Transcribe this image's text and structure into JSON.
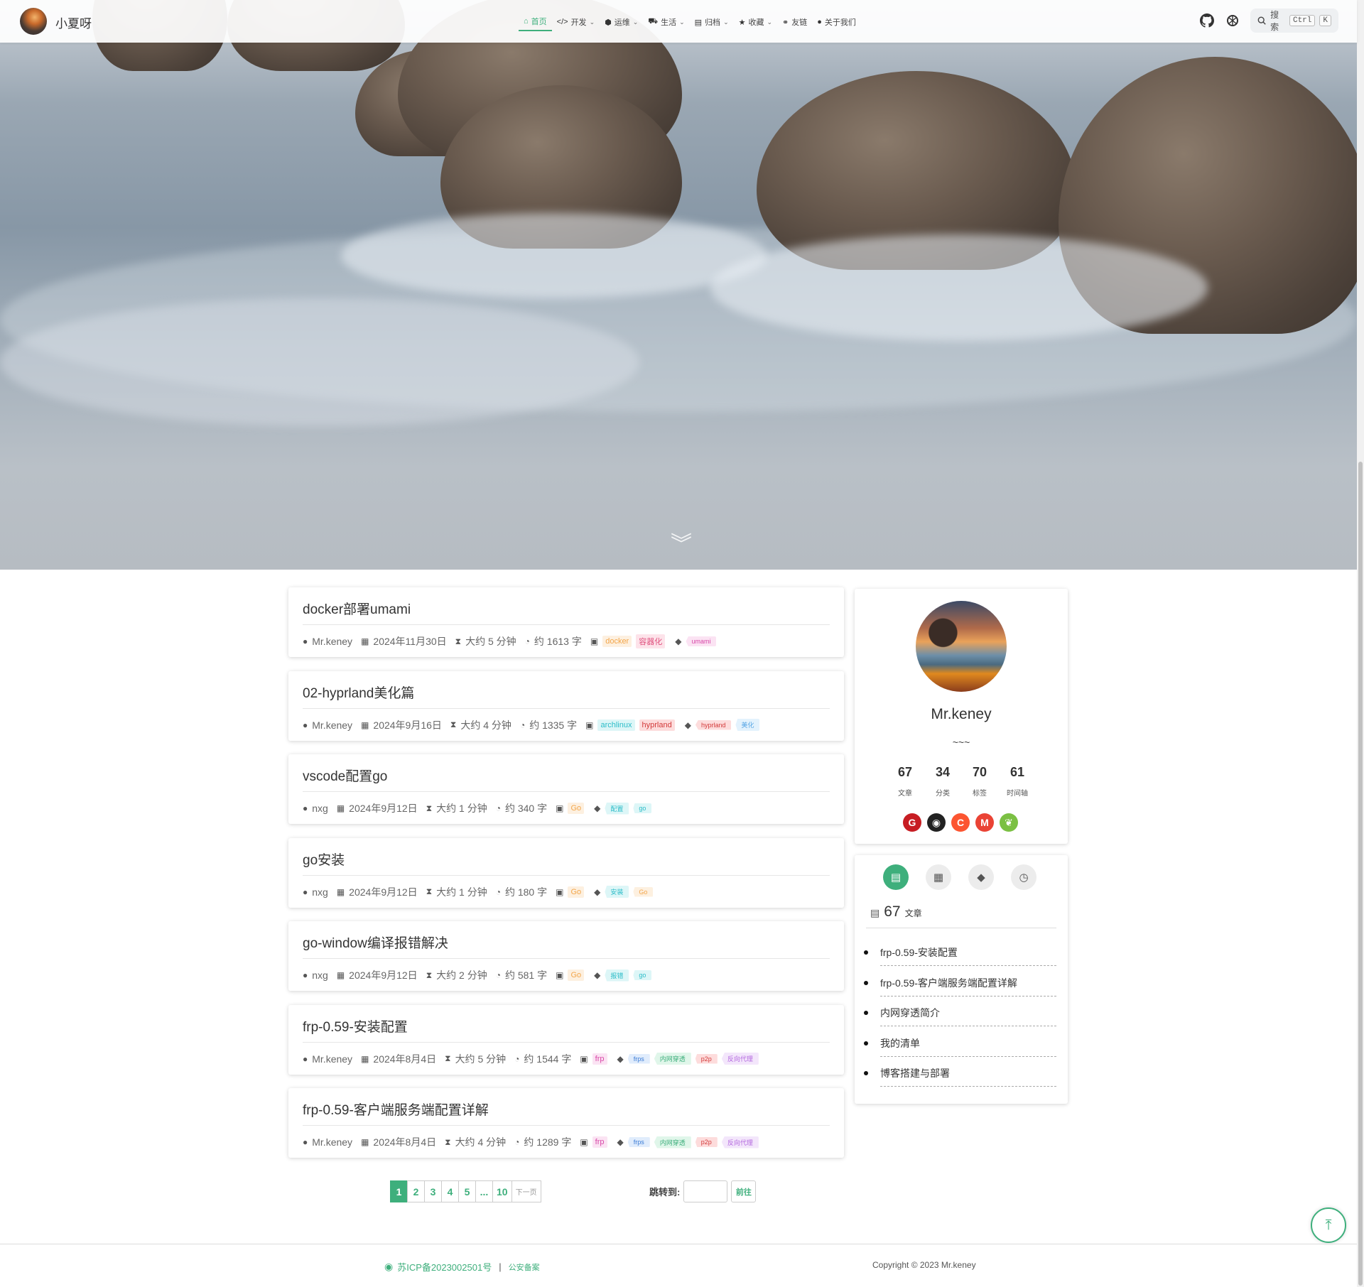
{
  "header": {
    "site_title": "小夏呀",
    "nav": [
      {
        "icon": "home-icon",
        "label": "首页",
        "dropdown": false,
        "active": true
      },
      {
        "icon": "code-icon",
        "label": "开发",
        "dropdown": true
      },
      {
        "icon": "box-icon",
        "label": "运维",
        "dropdown": true
      },
      {
        "icon": "car-icon",
        "label": "生活",
        "dropdown": true
      },
      {
        "icon": "calendar-icon",
        "label": "归档",
        "dropdown": true
      },
      {
        "icon": "star-icon",
        "label": "收藏",
        "dropdown": true
      },
      {
        "icon": "link-icon",
        "label": "友链",
        "dropdown": false
      },
      {
        "icon": "user-icon",
        "label": "关于我们",
        "dropdown": false
      }
    ],
    "search": {
      "label": "搜索",
      "key1": "Ctrl",
      "key2": "K"
    },
    "github_icon": "github-icon",
    "theme_icon": "theme-icon"
  },
  "posts": [
    {
      "title": "docker部署umami",
      "author": "Mr.keney",
      "date": "2024年11月30日",
      "read": "大约 5 分钟",
      "words": "约 1613 字",
      "categories": [
        {
          "text": "docker",
          "color": "orange"
        },
        {
          "text": "容器化",
          "color": "pink"
        }
      ],
      "tags": [
        {
          "text": "umami",
          "color": "magenta"
        }
      ]
    },
    {
      "title": "02-hyprland美化篇",
      "author": "Mr.keney",
      "date": "2024年9月16日",
      "read": "大约 4 分钟",
      "words": "约 1335 字",
      "categories": [
        {
          "text": "archlinux",
          "color": "cyan"
        },
        {
          "text": "hyprland",
          "color": "red"
        }
      ],
      "tags": [
        {
          "text": "hyprland",
          "color": "red"
        },
        {
          "text": "美化",
          "color": "lblue"
        }
      ]
    },
    {
      "title": "vscode配置go",
      "author": "nxg",
      "date": "2024年9月12日",
      "read": "大约 1 分钟",
      "words": "约 340 字",
      "categories": [
        {
          "text": "Go",
          "color": "orange"
        }
      ],
      "tags": [
        {
          "text": "配置",
          "color": "cyan"
        },
        {
          "text": "go",
          "color": "cyan"
        }
      ]
    },
    {
      "title": "go安装",
      "author": "nxg",
      "date": "2024年9月12日",
      "read": "大约 1 分钟",
      "words": "约 180 字",
      "categories": [
        {
          "text": "Go",
          "color": "orange"
        }
      ],
      "tags": [
        {
          "text": "安装",
          "color": "cyan"
        },
        {
          "text": "Go",
          "color": "orange"
        }
      ]
    },
    {
      "title": "go-window编译报错解决",
      "author": "nxg",
      "date": "2024年9月12日",
      "read": "大约 2 分钟",
      "words": "约 581 字",
      "categories": [
        {
          "text": "Go",
          "color": "orange"
        }
      ],
      "tags": [
        {
          "text": "报错",
          "color": "cyan"
        },
        {
          "text": "go",
          "color": "cyan"
        }
      ]
    },
    {
      "title": "frp-0.59-安装配置",
      "author": "Mr.keney",
      "date": "2024年8月4日",
      "read": "大约 5 分钟",
      "words": "约 1544 字",
      "categories": [
        {
          "text": "frp",
          "color": "magenta"
        }
      ],
      "tags": [
        {
          "text": "frps",
          "color": "blue"
        },
        {
          "text": "内网穿透",
          "color": "green"
        },
        {
          "text": "p2p",
          "color": "red"
        },
        {
          "text": "反向代理",
          "color": "purple"
        }
      ]
    },
    {
      "title": "frp-0.59-客户端服务端配置详解",
      "author": "Mr.keney",
      "date": "2024年8月4日",
      "read": "大约 4 分钟",
      "words": "约 1289 字",
      "categories": [
        {
          "text": "frp",
          "color": "magenta"
        }
      ],
      "tags": [
        {
          "text": "frps",
          "color": "blue"
        },
        {
          "text": "内网穿透",
          "color": "green"
        },
        {
          "text": "p2p",
          "color": "red"
        },
        {
          "text": "反向代理",
          "color": "purple"
        }
      ]
    }
  ],
  "profile": {
    "name": "Mr.keney",
    "signature": "~~~",
    "stats": [
      {
        "num": "67",
        "label": "文章"
      },
      {
        "num": "34",
        "label": "分类"
      },
      {
        "num": "70",
        "label": "标签"
      },
      {
        "num": "61",
        "label": "时间轴"
      }
    ],
    "socials": [
      {
        "name": "gitee-icon",
        "glyph": "G",
        "color": "#c71d23"
      },
      {
        "name": "github-icon",
        "glyph": "◉",
        "color": "#222222"
      },
      {
        "name": "csdn-icon",
        "glyph": "C",
        "color": "#fc5531"
      },
      {
        "name": "gmail-icon",
        "glyph": "M",
        "color": "#ea4335"
      },
      {
        "name": "leaf-icon",
        "glyph": "❦",
        "color": "#7bc043"
      }
    ]
  },
  "sidebar_tabs": {
    "tabs": [
      "article-tab-icon",
      "category-tab-icon",
      "tag-tab-icon",
      "timeline-tab-icon"
    ],
    "count_num": "67",
    "count_label": "文章",
    "recent": [
      "frp-0.59-安装配置",
      "frp-0.59-客户端服务端配置详解",
      "内网穿透简介",
      "我的清单",
      "博客搭建与部署"
    ]
  },
  "pagination": {
    "pages": [
      "1",
      "2",
      "3",
      "4",
      "5",
      "...",
      "10"
    ],
    "next": "下一页",
    "jump_label": "跳转到:",
    "jump_button": "前往"
  },
  "footer": {
    "icp": "苏ICP备2023002501号",
    "sep": "|",
    "police": "公安备案",
    "copyright": "Copyright © 2023 Mr.keney"
  },
  "colors": {
    "accent": "#3eaf7c"
  }
}
